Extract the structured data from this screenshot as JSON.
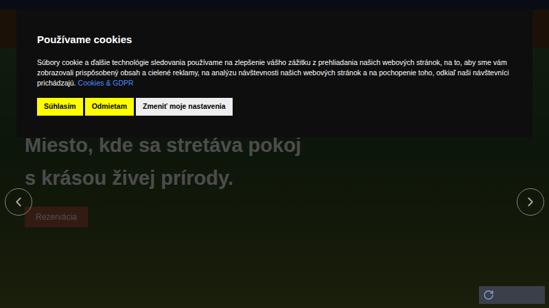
{
  "cookie_banner": {
    "title": "Používame cookies",
    "text": "Súbory cookie a ďalšie technológie sledovania používame na zlepšenie vášho zážitku z prehliadania našich webových stránok, na to, aby sme vám zobrazovali prispôsobený obsah a cielené reklamy, na analýzu návštevnosti našich webových stránok a na pochopenie toho, odkiaľ naši návštevníci prichádzajú.",
    "link": "Cookies & GDPR",
    "buttons": [
      {
        "label": "Súhlasím",
        "kind": "yellow"
      },
      {
        "label": "Odmietam",
        "kind": "yellow"
      },
      {
        "label": "Zmeniť moje nastavenia",
        "kind": "light"
      }
    ]
  },
  "hero": {
    "lines": [
      "Miesto, kde sa stretáva pokoj",
      "s krásou živej prírody."
    ],
    "button": "Rezervácia"
  }
}
